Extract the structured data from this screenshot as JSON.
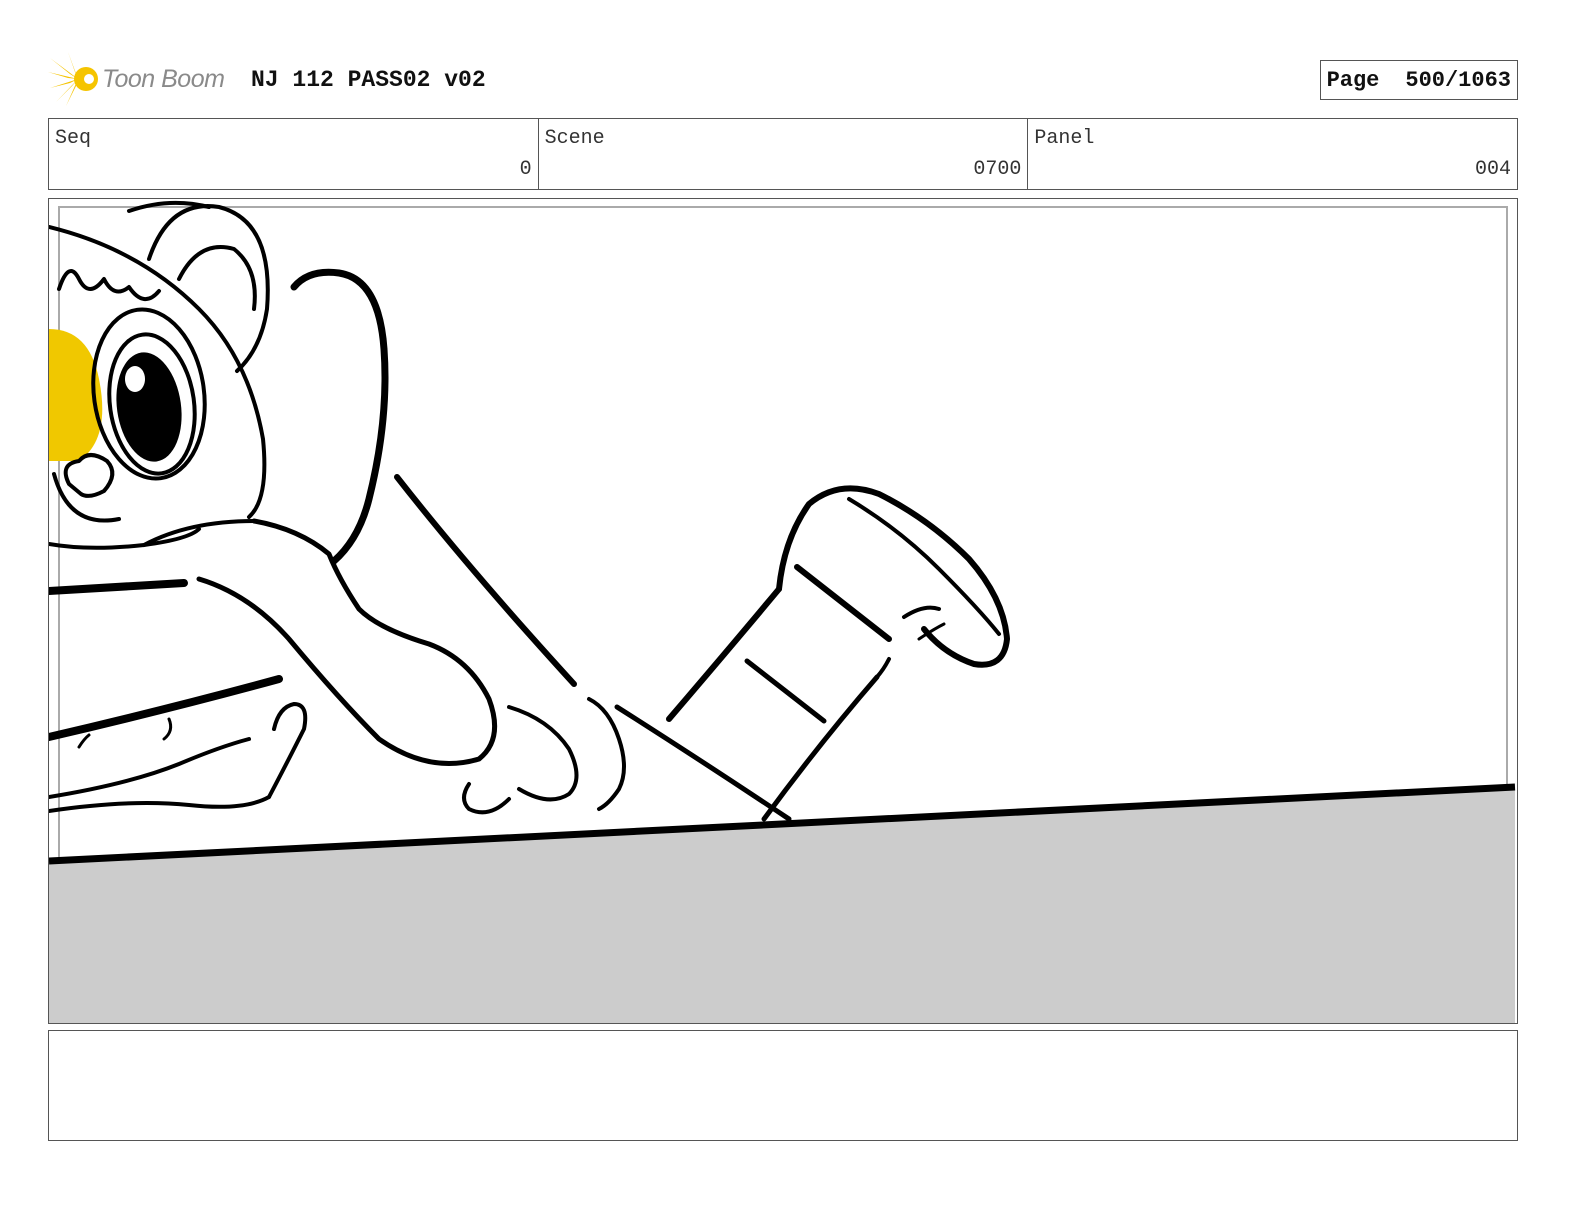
{
  "header": {
    "logo_text": "Toon Boom",
    "doc_title": "NJ 112 PASS02 v02",
    "page_label": "Page",
    "page_value": "500/1063"
  },
  "fields": [
    {
      "label": "Seq",
      "value": "0"
    },
    {
      "label": "Scene",
      "value": "0700"
    },
    {
      "label": "Panel",
      "value": "004"
    }
  ],
  "colors": {
    "logo_star": "#f5c400",
    "accent_yellow": "#f0c800",
    "floor_gray": "#cccccc",
    "ink": "#000000"
  },
  "icons": {
    "logo": "starburst-icon"
  },
  "notes": ""
}
